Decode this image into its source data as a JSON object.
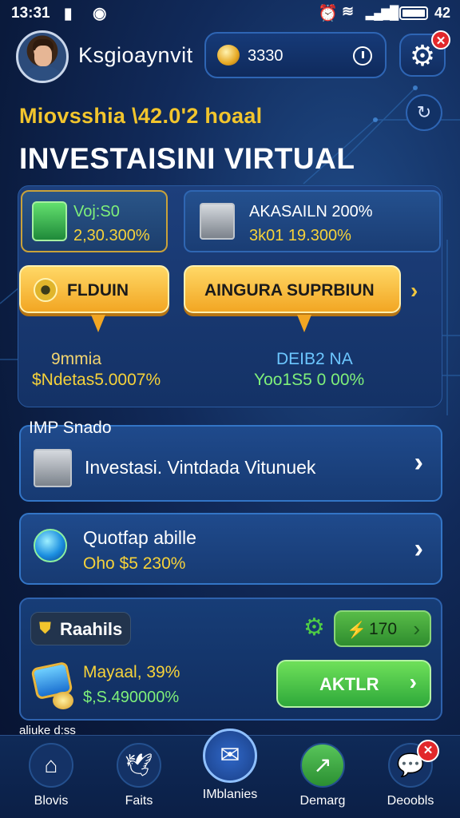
{
  "status_bar": {
    "time": "13:31",
    "battery_text": "42"
  },
  "header": {
    "username": "Ksgioaynvit",
    "coins": "3330",
    "promo_text": "Miovsshia \\42.0'2 hoaal",
    "title": "INVESTAISINI VIRTUAL"
  },
  "cards": [
    {
      "label": "Voj:S0",
      "value": "2,30.300%"
    },
    {
      "label": "AKASAILN 200%",
      "value": "3k01 19.300%"
    }
  ],
  "pills": [
    {
      "label": "FLDUIN",
      "sub_label": "9mmia",
      "sub_value": "$Ndetas5.0007%"
    },
    {
      "label": "AINGURA SUPRBIUN",
      "sub_label": "DEIB2 NA",
      "sub_value": "Yoo1S5 0 00%"
    }
  ],
  "section_label": "IMP Snado",
  "rows": [
    {
      "text": "Investasi. Vintdada Vitunuek"
    },
    {
      "title": "Quotfap abille",
      "value": "Oho $5 230%"
    }
  ],
  "bottom_box": {
    "tag": "Raahils",
    "green_value": "170",
    "item_title": "Mayaal, 39%",
    "item_value": "$,S.490000%",
    "button": "AKTLR",
    "footer_text": "aliuke d:ss"
  },
  "nav": [
    {
      "label": "Blovis",
      "icon": "home-icon"
    },
    {
      "label": "Faits",
      "icon": "bird-icon"
    },
    {
      "label": "IMblanies",
      "icon": "mail-icon"
    },
    {
      "label": "Demarg",
      "icon": "arrow-up-icon"
    },
    {
      "label": "Deoobls",
      "icon": "chat-icon"
    }
  ],
  "colors": {
    "accent_gold": "#f2c52d",
    "accent_green": "#4fcc45",
    "badge_red": "#e2282b",
    "bg": "#0f2a5c"
  }
}
